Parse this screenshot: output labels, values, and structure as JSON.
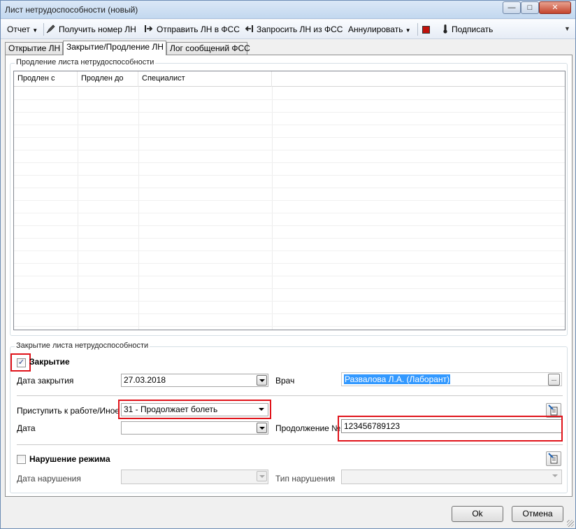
{
  "window": {
    "title": "Лист нетрудоспособности (новый)"
  },
  "toolbar": {
    "report": "Отчет",
    "get_number": "Получить номер ЛН",
    "send": "Отправить ЛН в ФСС",
    "request": "Запросить ЛН из ФСС",
    "cancel": "Аннулировать",
    "sign": "Подписать"
  },
  "tabs": [
    {
      "label": "Открытие ЛН"
    },
    {
      "label": "Закрытие/Продление ЛН"
    },
    {
      "label": "Лог сообщений ФСС"
    }
  ],
  "extension": {
    "legend": "Продление листа нетрудоспособности",
    "columns": [
      "Продлен с",
      "Продлен до",
      "Специалист"
    ]
  },
  "closure": {
    "legend": "Закрытие листа нетрудоспособности",
    "checkbox_label": "Закрытие",
    "checked": true,
    "date_label": "Дата закрытия",
    "date_value": "27.03.2018",
    "doctor_label": "Врач",
    "doctor_value": "Развалова Л.А. (Лаборант)",
    "return_label": "Приступить к работе/Иное",
    "return_value": "31 - Продолжает болеть",
    "date2_label": "Дата",
    "date2_value": "",
    "continuation_label": "Продолжение №",
    "continuation_value": "123456789123"
  },
  "violation": {
    "checkbox_label": "Нарушение режима",
    "checked": false,
    "date_label": "Дата нарушения",
    "type_label": "Тип нарушения"
  },
  "footer": {
    "ok": "Ok",
    "cancel": "Отмена"
  },
  "colors": {
    "highlight": "#e0131a",
    "selection": "#3399ff"
  }
}
